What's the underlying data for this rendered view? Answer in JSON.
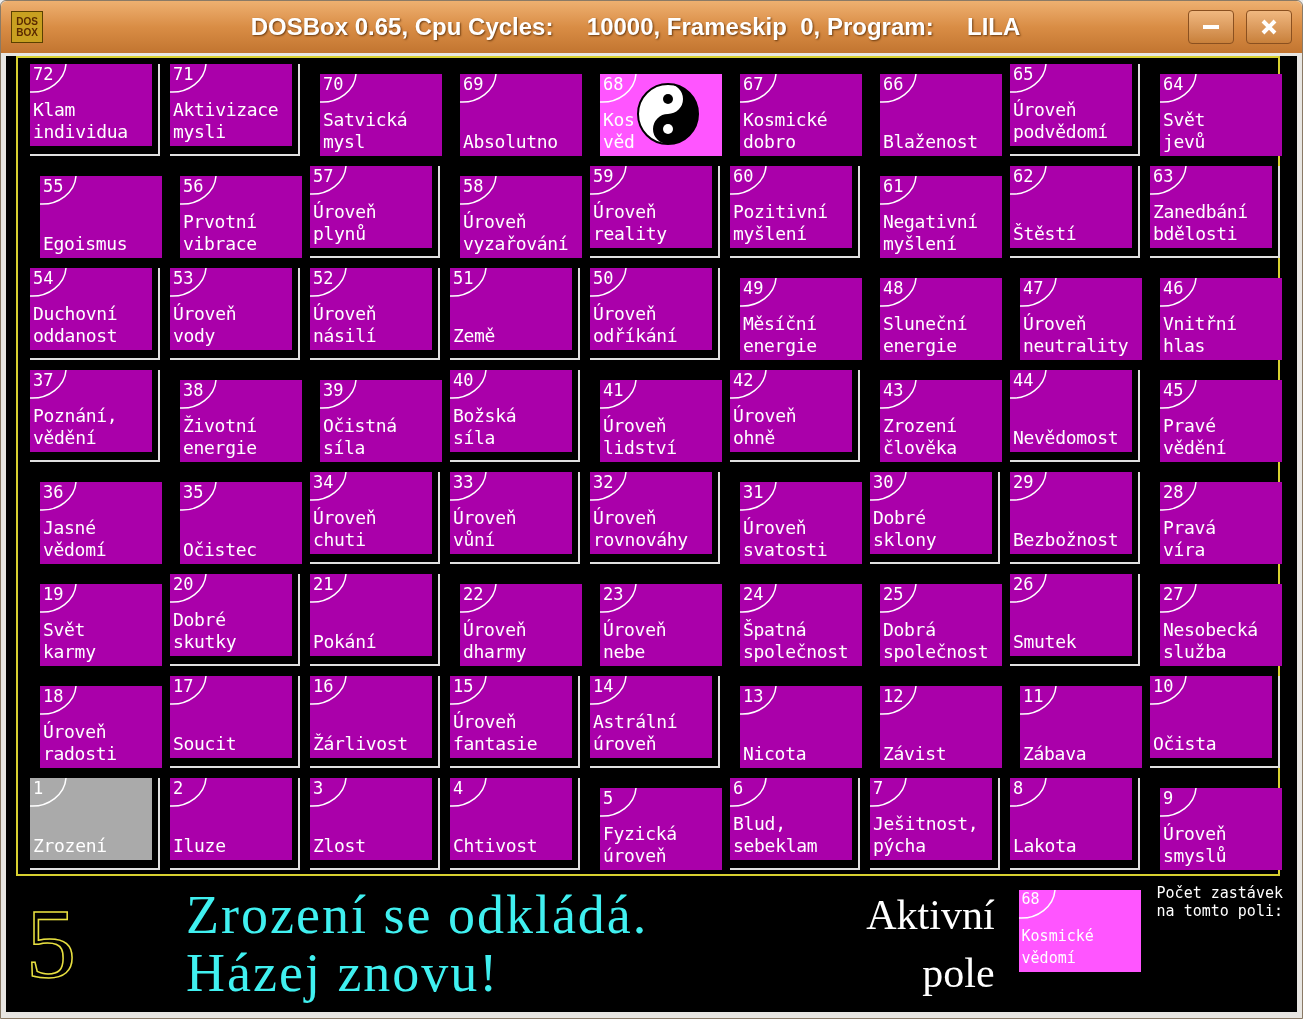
{
  "window": {
    "title": "DOSBox 0.65, Cpu Cycles:     10000, Frameskip  0, Program:     LILA",
    "app_icon_text": [
      "DOS",
      "BOX"
    ]
  },
  "board": {
    "rows": [
      [
        {
          "number": "72",
          "lines": [
            "Klam",
            "individua"
          ],
          "raised": true,
          "active": false,
          "current": false
        },
        {
          "number": "71",
          "lines": [
            "Aktivizace",
            "mysli"
          ],
          "raised": true,
          "active": false,
          "current": false
        },
        {
          "number": "70",
          "lines": [
            "Satvická",
            "mysl"
          ],
          "raised": false,
          "active": false,
          "current": false
        },
        {
          "number": "69",
          "lines": [
            "Absolutno"
          ],
          "raised": false,
          "active": false,
          "current": false
        },
        {
          "number": "68",
          "lines": [
            "Kos",
            "věd"
          ],
          "raised": false,
          "active": true,
          "current": false,
          "token": true
        },
        {
          "number": "67",
          "lines": [
            "Kosmické",
            "dobro"
          ],
          "raised": false,
          "active": false,
          "current": false
        },
        {
          "number": "66",
          "lines": [
            "Blaženost"
          ],
          "raised": false,
          "active": false,
          "current": false
        },
        {
          "number": "65",
          "lines": [
            "Úroveň",
            "podvědomí"
          ],
          "raised": true,
          "active": false,
          "current": false
        },
        {
          "number": "64",
          "lines": [
            "Svět",
            "jevů"
          ],
          "raised": false,
          "active": false,
          "current": false
        }
      ],
      [
        {
          "number": "55",
          "lines": [
            "Egoismus"
          ],
          "raised": false,
          "active": false,
          "current": false
        },
        {
          "number": "56",
          "lines": [
            "Prvotní",
            "vibrace"
          ],
          "raised": false,
          "active": false,
          "current": false
        },
        {
          "number": "57",
          "lines": [
            "Úroveň",
            "plynů"
          ],
          "raised": true,
          "active": false,
          "current": false
        },
        {
          "number": "58",
          "lines": [
            "Úroveň",
            "vyzařování"
          ],
          "raised": false,
          "active": false,
          "current": false
        },
        {
          "number": "59",
          "lines": [
            "Úroveň",
            "reality"
          ],
          "raised": true,
          "active": false,
          "current": false
        },
        {
          "number": "60",
          "lines": [
            "Pozitivní",
            "myšlení"
          ],
          "raised": true,
          "active": false,
          "current": false
        },
        {
          "number": "61",
          "lines": [
            "Negativní",
            "myšlení"
          ],
          "raised": false,
          "active": false,
          "current": false
        },
        {
          "number": "62",
          "lines": [
            "Štěstí"
          ],
          "raised": true,
          "active": false,
          "current": false
        },
        {
          "number": "63",
          "lines": [
            "Zanedbání",
            "bdělosti"
          ],
          "raised": true,
          "active": false,
          "current": false
        }
      ],
      [
        {
          "number": "54",
          "lines": [
            "Duchovní",
            "oddanost"
          ],
          "raised": true,
          "active": false,
          "current": false
        },
        {
          "number": "53",
          "lines": [
            "Úroveň",
            "vody"
          ],
          "raised": true,
          "active": false,
          "current": false
        },
        {
          "number": "52",
          "lines": [
            "Úroveň",
            "násilí"
          ],
          "raised": true,
          "active": false,
          "current": false
        },
        {
          "number": "51",
          "lines": [
            "Země"
          ],
          "raised": true,
          "active": false,
          "current": false
        },
        {
          "number": "50",
          "lines": [
            "Úroveň",
            "odříkání"
          ],
          "raised": true,
          "active": false,
          "current": false
        },
        {
          "number": "49",
          "lines": [
            "Měsíční",
            "energie"
          ],
          "raised": false,
          "active": false,
          "current": false
        },
        {
          "number": "48",
          "lines": [
            "Sluneční",
            "energie"
          ],
          "raised": false,
          "active": false,
          "current": false
        },
        {
          "number": "47",
          "lines": [
            "Úroveň",
            "neutrality"
          ],
          "raised": false,
          "active": false,
          "current": false
        },
        {
          "number": "46",
          "lines": [
            "Vnitřní",
            "hlas"
          ],
          "raised": false,
          "active": false,
          "current": false
        }
      ],
      [
        {
          "number": "37",
          "lines": [
            "Poznání,",
            "vědění"
          ],
          "raised": true,
          "active": false,
          "current": false
        },
        {
          "number": "38",
          "lines": [
            "Životní",
            "energie"
          ],
          "raised": false,
          "active": false,
          "current": false
        },
        {
          "number": "39",
          "lines": [
            "Očistná",
            "síla"
          ],
          "raised": false,
          "active": false,
          "current": false
        },
        {
          "number": "40",
          "lines": [
            "Božská",
            "síla"
          ],
          "raised": true,
          "active": false,
          "current": false
        },
        {
          "number": "41",
          "lines": [
            "Úroveň",
            "lidství"
          ],
          "raised": false,
          "active": false,
          "current": false
        },
        {
          "number": "42",
          "lines": [
            "Úroveň",
            "ohně"
          ],
          "raised": true,
          "active": false,
          "current": false
        },
        {
          "number": "43",
          "lines": [
            "Zrození",
            "člověka"
          ],
          "raised": false,
          "active": false,
          "current": false
        },
        {
          "number": "44",
          "lines": [
            "Nevědomost"
          ],
          "raised": true,
          "active": false,
          "current": false
        },
        {
          "number": "45",
          "lines": [
            "Pravé",
            "vědění"
          ],
          "raised": false,
          "active": false,
          "current": false
        }
      ],
      [
        {
          "number": "36",
          "lines": [
            "Jasné",
            "vědomí"
          ],
          "raised": false,
          "active": false,
          "current": false
        },
        {
          "number": "35",
          "lines": [
            "Očistec"
          ],
          "raised": false,
          "active": false,
          "current": false
        },
        {
          "number": "34",
          "lines": [
            "Úroveň",
            "chuti"
          ],
          "raised": true,
          "active": false,
          "current": false
        },
        {
          "number": "33",
          "lines": [
            "Úroveň",
            "vůní"
          ],
          "raised": true,
          "active": false,
          "current": false
        },
        {
          "number": "32",
          "lines": [
            "Úroveň",
            "rovnováhy"
          ],
          "raised": true,
          "active": false,
          "current": false
        },
        {
          "number": "31",
          "lines": [
            "Úroveň",
            "svatosti"
          ],
          "raised": false,
          "active": false,
          "current": false
        },
        {
          "number": "30",
          "lines": [
            "Dobré",
            "sklony"
          ],
          "raised": true,
          "active": false,
          "current": false
        },
        {
          "number": "29",
          "lines": [
            "Bezbožnost"
          ],
          "raised": true,
          "active": false,
          "current": false
        },
        {
          "number": "28",
          "lines": [
            "Pravá",
            "víra"
          ],
          "raised": false,
          "active": false,
          "current": false
        }
      ],
      [
        {
          "number": "19",
          "lines": [
            "Svět",
            "karmy"
          ],
          "raised": false,
          "active": false,
          "current": false
        },
        {
          "number": "20",
          "lines": [
            "Dobré",
            "skutky"
          ],
          "raised": true,
          "active": false,
          "current": false
        },
        {
          "number": "21",
          "lines": [
            "Pokání"
          ],
          "raised": true,
          "active": false,
          "current": false
        },
        {
          "number": "22",
          "lines": [
            "Úroveň",
            "dharmy"
          ],
          "raised": false,
          "active": false,
          "current": false
        },
        {
          "number": "23",
          "lines": [
            "Úroveň",
            "nebe"
          ],
          "raised": false,
          "active": false,
          "current": false
        },
        {
          "number": "24",
          "lines": [
            "Špatná",
            "společnost"
          ],
          "raised": false,
          "active": false,
          "current": false
        },
        {
          "number": "25",
          "lines": [
            "Dobrá",
            "společnost"
          ],
          "raised": false,
          "active": false,
          "current": false
        },
        {
          "number": "26",
          "lines": [
            "Smutek"
          ],
          "raised": true,
          "active": false,
          "current": false
        },
        {
          "number": "27",
          "lines": [
            "Nesobecká",
            "služba"
          ],
          "raised": false,
          "active": false,
          "current": false
        }
      ],
      [
        {
          "number": "18",
          "lines": [
            "Úroveň",
            "radosti"
          ],
          "raised": false,
          "active": false,
          "current": false
        },
        {
          "number": "17",
          "lines": [
            "Soucit"
          ],
          "raised": true,
          "active": false,
          "current": false
        },
        {
          "number": "16",
          "lines": [
            "Žárlivost"
          ],
          "raised": true,
          "active": false,
          "current": false
        },
        {
          "number": "15",
          "lines": [
            "Úroveň",
            "fantasie"
          ],
          "raised": true,
          "active": false,
          "current": false
        },
        {
          "number": "14",
          "lines": [
            "Astrální",
            "úroveň"
          ],
          "raised": true,
          "active": false,
          "current": false
        },
        {
          "number": "13",
          "lines": [
            "Nicota"
          ],
          "raised": false,
          "active": false,
          "current": false
        },
        {
          "number": "12",
          "lines": [
            "Závist"
          ],
          "raised": false,
          "active": false,
          "current": false
        },
        {
          "number": "11",
          "lines": [
            "Zábava"
          ],
          "raised": false,
          "active": false,
          "current": false
        },
        {
          "number": "10",
          "lines": [
            "Očista"
          ],
          "raised": true,
          "active": false,
          "current": false
        }
      ],
      [
        {
          "number": "1",
          "lines": [
            "Zrození"
          ],
          "raised": true,
          "active": false,
          "current": true
        },
        {
          "number": "2",
          "lines": [
            "Iluze"
          ],
          "raised": true,
          "active": false,
          "current": false
        },
        {
          "number": "3",
          "lines": [
            "Zlost"
          ],
          "raised": true,
          "active": false,
          "current": false
        },
        {
          "number": "4",
          "lines": [
            "Chtivost"
          ],
          "raised": true,
          "active": false,
          "current": false
        },
        {
          "number": "5",
          "lines": [
            "Fyzická",
            "úroveň"
          ],
          "raised": false,
          "active": false,
          "current": false
        },
        {
          "number": "6",
          "lines": [
            "Blud,",
            "sebeklam"
          ],
          "raised": true,
          "active": false,
          "current": false
        },
        {
          "number": "7",
          "lines": [
            "Ješitnost,",
            "pýcha"
          ],
          "raised": true,
          "active": false,
          "current": false
        },
        {
          "number": "8",
          "lines": [
            "Lakota"
          ],
          "raised": true,
          "active": false,
          "current": false
        },
        {
          "number": "9",
          "lines": [
            "Úroveň",
            "smyslů"
          ],
          "raised": false,
          "active": false,
          "current": false
        }
      ]
    ]
  },
  "status": {
    "dice": "5",
    "message": [
      "Zrození se odkládá.",
      "Házej znovu!"
    ],
    "active_label": [
      "Aktivní",
      "pole"
    ],
    "active_square": {
      "number": "68",
      "lines": [
        "Kosmické",
        "vědomí"
      ]
    },
    "stops_label": [
      "Počet zastávek",
      "na tomto poli:"
    ]
  }
}
